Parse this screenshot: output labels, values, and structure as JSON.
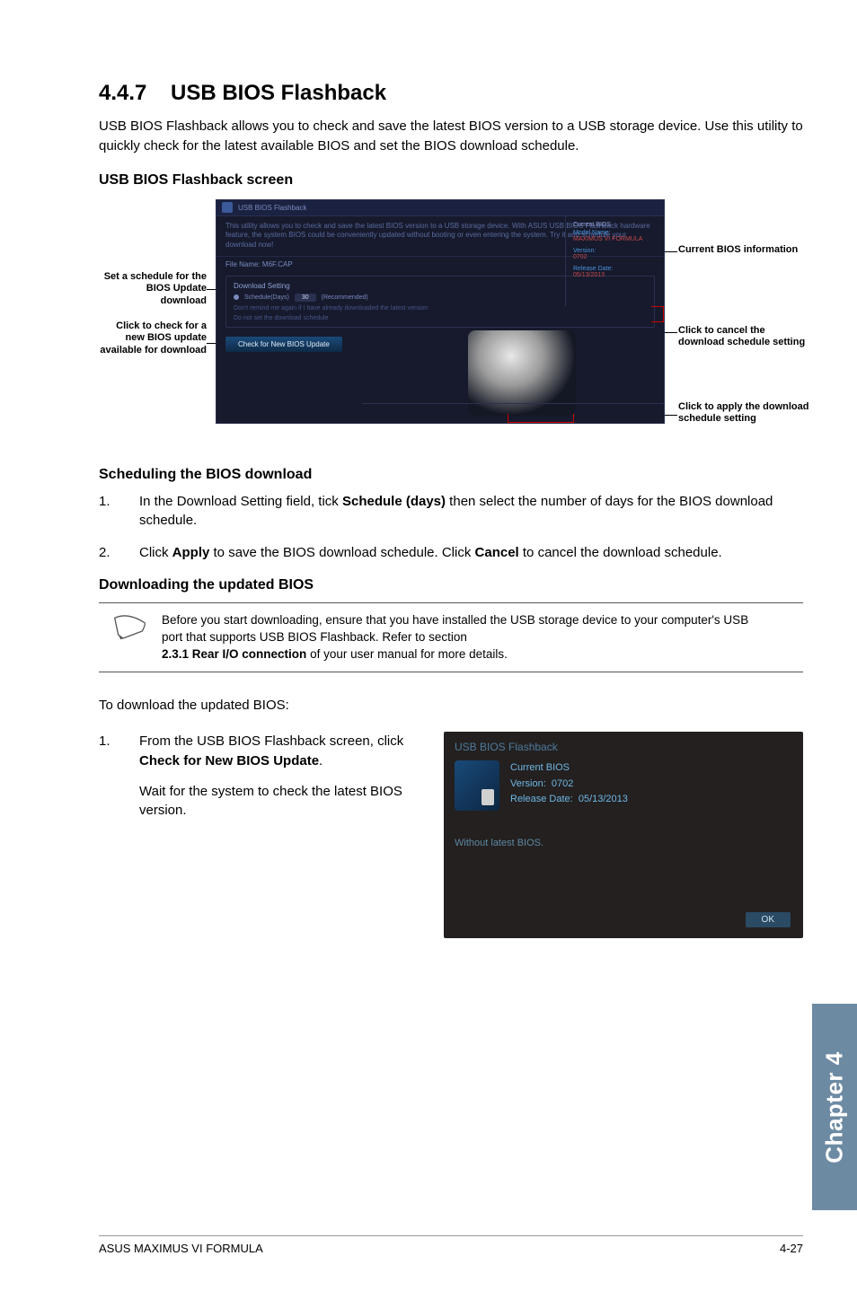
{
  "section": {
    "number": "4.4.7",
    "title": "USB BIOS Flashback"
  },
  "intro": "USB BIOS Flashback allows you to check and save the latest BIOS version to a USB storage device. Use this utility to quickly check for the latest available BIOS and set the BIOS download schedule.",
  "screen_heading": "USB BIOS Flashback screen",
  "callouts": {
    "set_schedule": "Set a schedule for the BIOS Update download",
    "click_check": "Click to check for a new BIOS update available for download",
    "current_bios": "Current BIOS information",
    "click_cancel": "Click to cancel the download schedule setting",
    "click_apply": "Click to apply the download schedule setting"
  },
  "screenshot": {
    "window_title": "USB BIOS Flashback",
    "description": "This utility allows you to check and save the latest BIOS version to a USB storage device. With ASUS USB BIOS Flashback hardware feature, the system BIOS could be conveniently updated without booting or even entering the system. Try it and schedule your download now!",
    "file_name_label": "File Name:",
    "file_name_value": "M6F.CAP",
    "panel_title": "Download Setting",
    "schedule_label": "Schedule(Days)",
    "schedule_value": "30",
    "recommended": "(Recommended)",
    "subnote1": "Don't remind me again if I have already downloaded the latest version",
    "subnote2": "Do not set the download schedule",
    "check_button": "Check for New BIOS Update",
    "sidebar": {
      "current_bios_label": "Current BIOS",
      "model_label": "Model Name:",
      "model_value": "MAXIMUS VI FORMULA",
      "version_label": "Version:",
      "version_value": "0702",
      "release_label": "Release Date:",
      "release_value": "05/13/2013"
    }
  },
  "scheduling": {
    "heading": "Scheduling the BIOS download",
    "step1_pre": "In the Download Setting field, tick ",
    "step1_bold": "Schedule (days)",
    "step1_post": " then select the number of days for the BIOS download schedule.",
    "step2_pre": "Click ",
    "step2_bold1": "Apply",
    "step2_mid": " to save the BIOS download schedule. Click ",
    "step2_bold2": "Cancel",
    "step2_post": " to cancel the download schedule."
  },
  "downloading": {
    "heading": "Downloading the updated BIOS",
    "note_line1": "Before you start downloading, ensure that you have installed the USB storage device to your computer's USB port that supports USB BIOS Flashback. Refer to section",
    "note_bold": "2.3.1 Rear I/O connection",
    "note_line2": " of your user manual for more details.",
    "intro": "To download the updated BIOS:",
    "step1_pre": "From the USB BIOS Flashback screen, click ",
    "step1_bold": "Check for New BIOS Update",
    "step1_post": ".",
    "step1_wait": "Wait for the system to check the latest BIOS version."
  },
  "dialog": {
    "title": "USB BIOS Flashback",
    "current_label": "Current BIOS",
    "version_label": "Version:",
    "version_value": "0702",
    "release_label": "Release Date:",
    "release_value": "05/13/2013",
    "without": "Without latest BIOS.",
    "ok": "OK"
  },
  "chapter_tab": "Chapter 4",
  "footer": {
    "left": "ASUS MAXIMUS VI FORMULA",
    "right": "4-27"
  }
}
